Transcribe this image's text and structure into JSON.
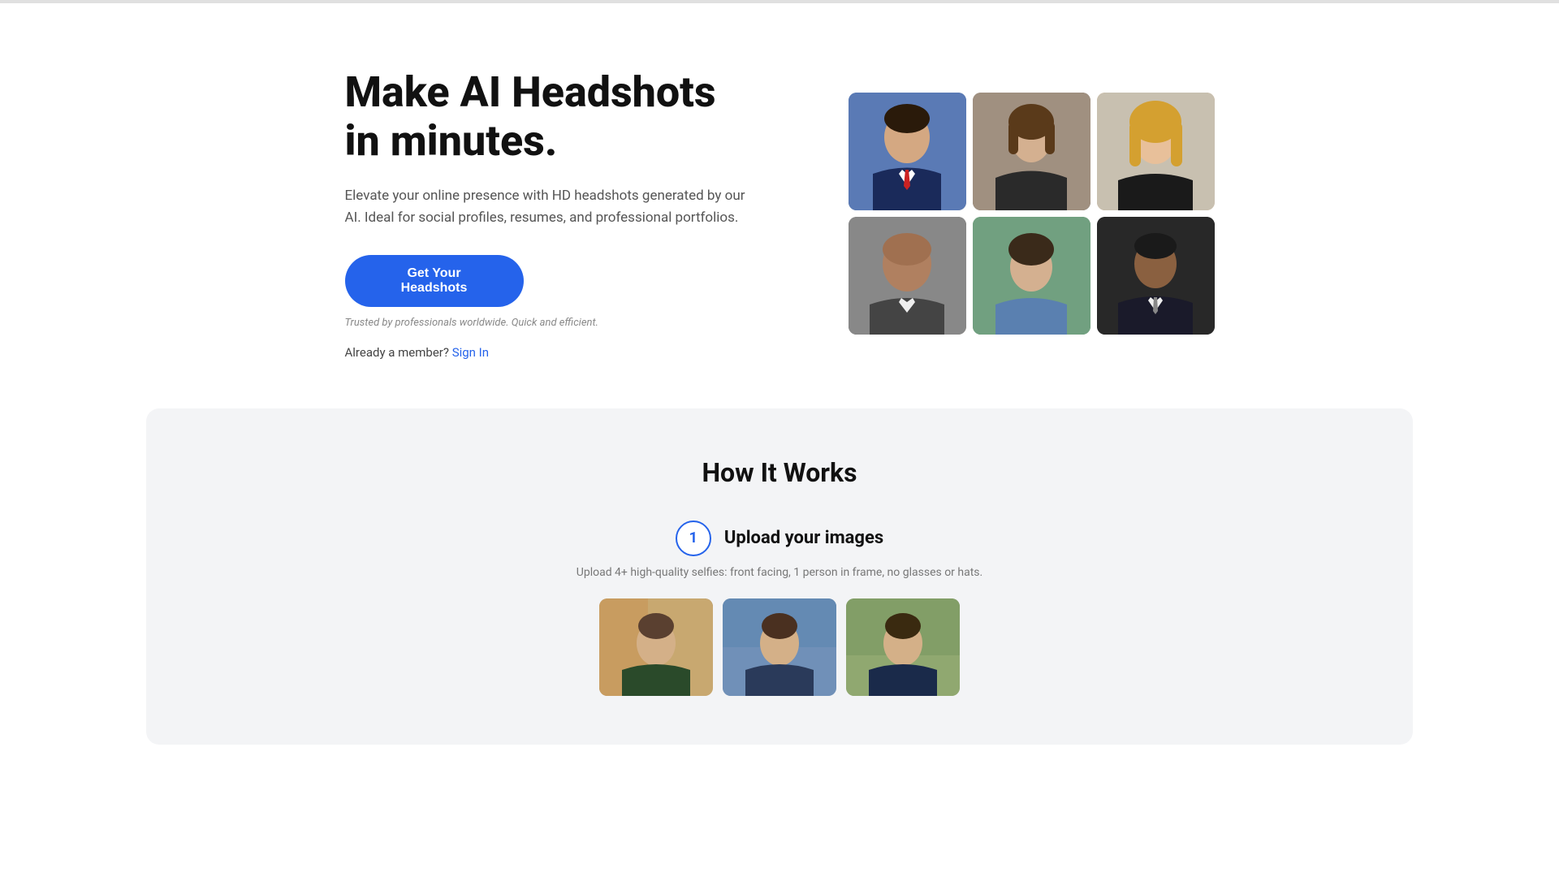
{
  "topBar": {
    "visible": true
  },
  "hero": {
    "title": "Make AI Headshots\nin minutes.",
    "description": "Elevate your online presence with HD headshots generated by our AI. Ideal for social profiles, resumes, and professional portfolios.",
    "ctaButton": "Get Your Headshots",
    "trustedText": "Trusted by professionals worldwide. Quick and efficient.",
    "alreadyMember": "Already a member?",
    "signInLink": "Sign In"
  },
  "headshotGrid": {
    "images": [
      {
        "id": 1,
        "alt": "Professional male headshot in suit"
      },
      {
        "id": 2,
        "alt": "Professional female headshot in dark jacket"
      },
      {
        "id": 3,
        "alt": "Professional female headshot with blonde hair"
      },
      {
        "id": 4,
        "alt": "Bald male professional headshot"
      },
      {
        "id": 5,
        "alt": "Young male headshot outdoors"
      },
      {
        "id": 6,
        "alt": "Black male professional headshot in suit"
      }
    ]
  },
  "howItWorks": {
    "title": "How It Works",
    "step1": {
      "number": "1",
      "title": "Upload your images",
      "description": "Upload 4+ high-quality selfies: front facing, 1 person in frame, no glasses or hats.",
      "sampleImages": [
        {
          "id": 1,
          "alt": "Sample selfie 1"
        },
        {
          "id": 2,
          "alt": "Sample selfie 2"
        },
        {
          "id": 3,
          "alt": "Sample selfie 3"
        }
      ]
    }
  }
}
